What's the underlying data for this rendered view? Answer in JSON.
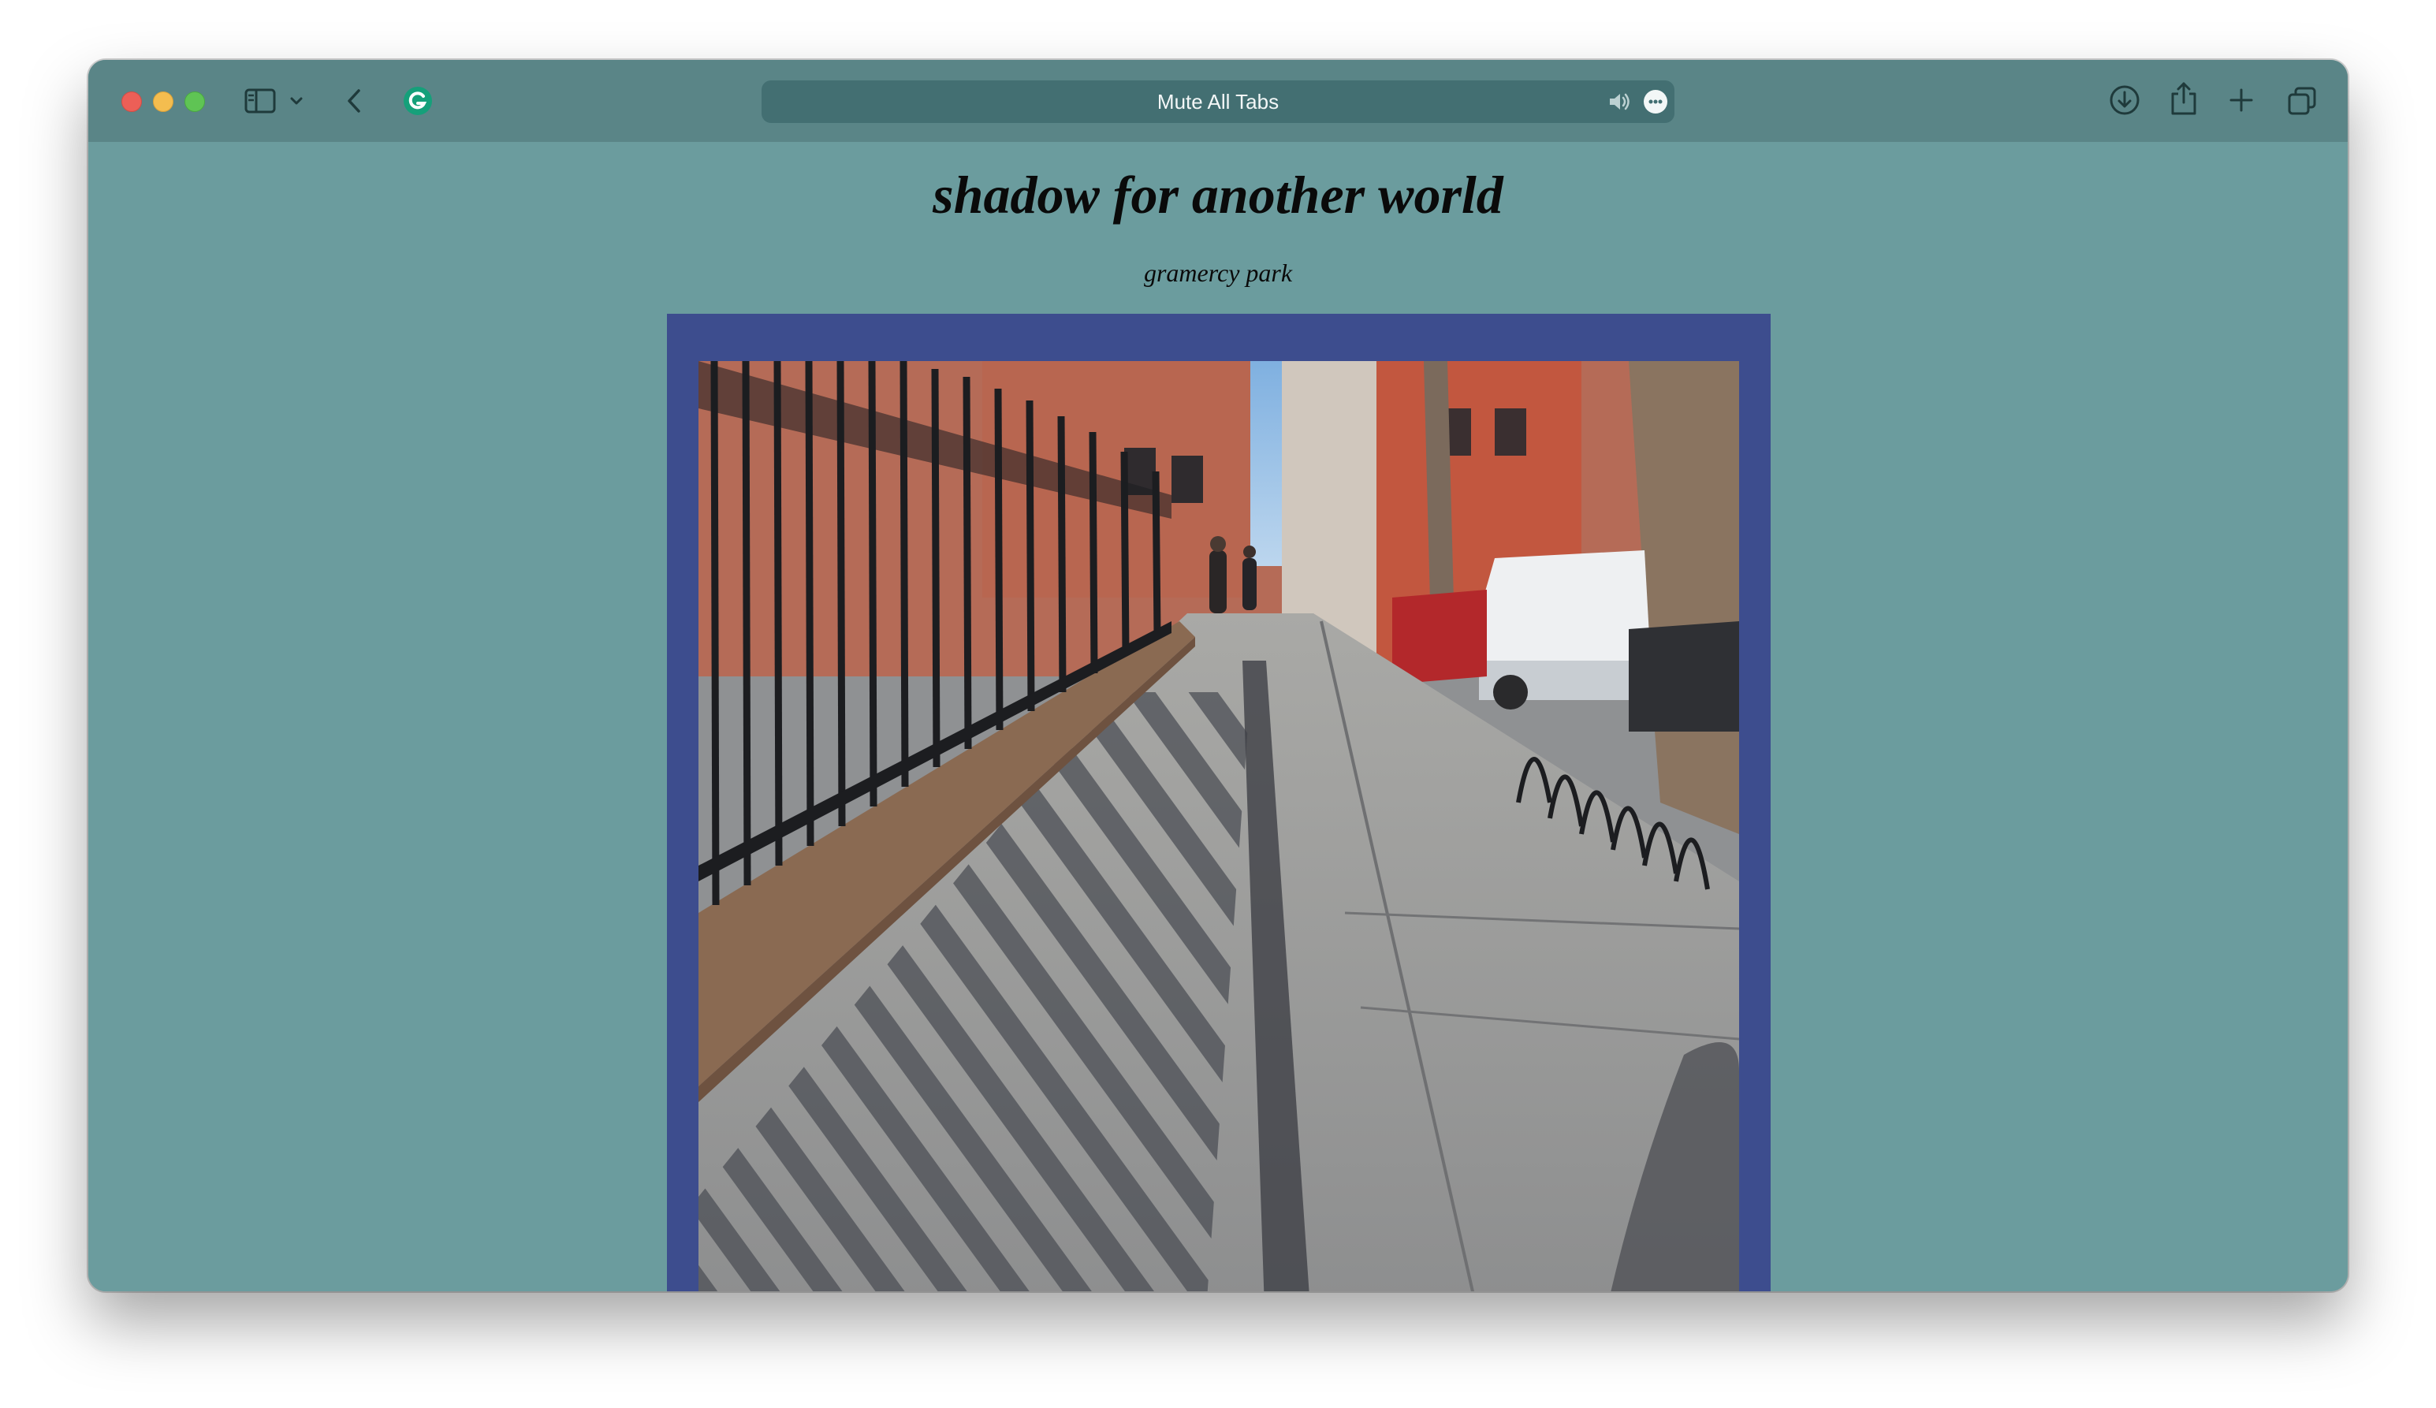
{
  "browser": {
    "address_bar_text": "Mute All Tabs",
    "icons": {
      "sidebar": "sidebar-icon",
      "sidebar_menu": "chevron-down-icon",
      "back": "chevron-left-icon",
      "extension": "grammarly-icon",
      "audio": "speaker-icon",
      "page_menu": "more-icon",
      "downloads": "download-icon",
      "share": "share-icon",
      "new_tab": "plus-icon",
      "tab_overview": "tabs-icon"
    },
    "colors": {
      "toolbar": "#5a8587",
      "address_bar": "#436f72"
    }
  },
  "page": {
    "title": "shadow for another world",
    "subtitle": "gramercy park",
    "photo_description_label": "",
    "colors": {
      "background": "#6b9c9e",
      "photo_frame": "#3d4d8e",
      "text": "#0a0a0a"
    }
  }
}
